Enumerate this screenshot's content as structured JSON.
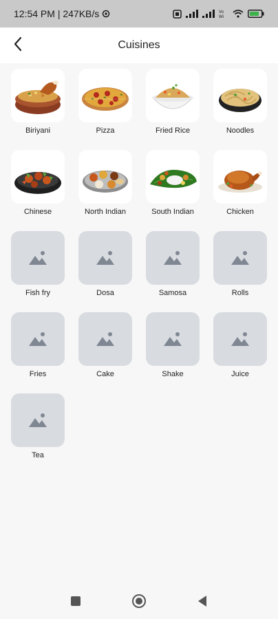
{
  "status_bar": {
    "time_speed": "12:54 PM | 247KB/s",
    "icons": [
      "settings-icon",
      "sim-icon",
      "signal-icon",
      "signal-icon",
      "volte-wifi-icon",
      "wifi-icon",
      "battery-icon"
    ]
  },
  "app_bar": {
    "title": "Cuisines",
    "back_icon": "chevron-left-icon"
  },
  "cuisines": [
    {
      "label": "Biriyani",
      "image": "biriyani"
    },
    {
      "label": "Pizza",
      "image": "pizza"
    },
    {
      "label": "Fried Rice",
      "image": "fried-rice"
    },
    {
      "label": "Noodles",
      "image": "noodles"
    },
    {
      "label": "Chinese",
      "image": "chinese"
    },
    {
      "label": "North Indian",
      "image": "north-indian"
    },
    {
      "label": "South Indian",
      "image": "south-indian"
    },
    {
      "label": "Chicken",
      "image": "chicken"
    },
    {
      "label": "Fish fry",
      "image": "placeholder"
    },
    {
      "label": "Dosa",
      "image": "placeholder"
    },
    {
      "label": "Samosa",
      "image": "placeholder"
    },
    {
      "label": "Rolls",
      "image": "placeholder"
    },
    {
      "label": "Fries",
      "image": "placeholder"
    },
    {
      "label": "Cake",
      "image": "placeholder"
    },
    {
      "label": "Shake",
      "image": "placeholder"
    },
    {
      "label": "Juice",
      "image": "placeholder"
    },
    {
      "label": "Tea",
      "image": "placeholder"
    }
  ],
  "nav_bar": {
    "icons": [
      "recents-square-icon",
      "home-circle-icon",
      "back-triangle-icon"
    ]
  },
  "colors": {
    "status_bar_bg": "#c9c9c9",
    "page_bg": "#f7f7f7",
    "placeholder_bg": "#d8dbe0",
    "placeholder_icon": "#7f8793"
  }
}
